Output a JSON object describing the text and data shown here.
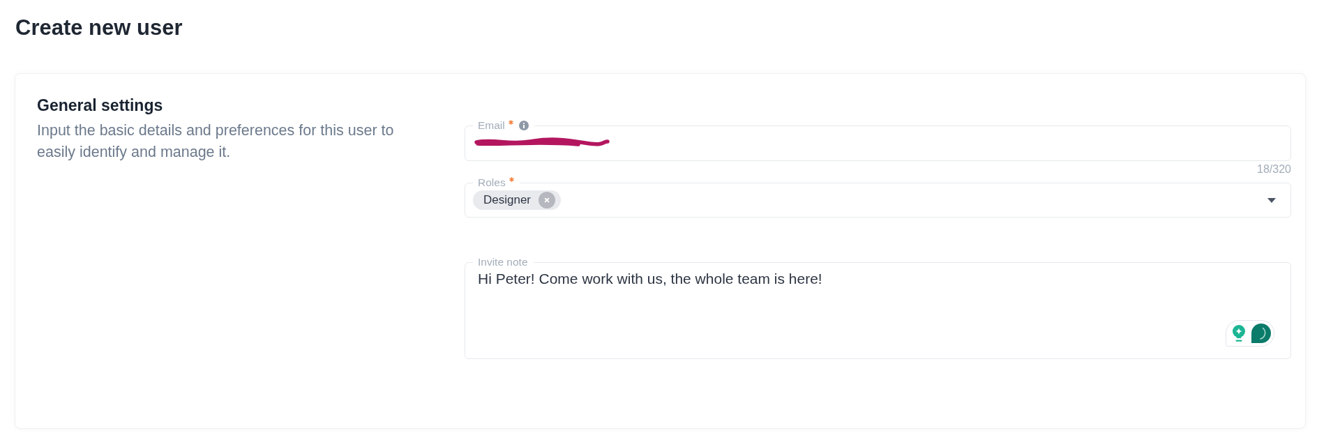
{
  "page": {
    "title": "Create new user"
  },
  "section": {
    "title": "General settings",
    "description": "Input the basic details and preferences for this user to easily identify and manage it."
  },
  "fields": [
    {
      "kind": "text",
      "label": "Email",
      "required": true,
      "info": true,
      "redacted": true,
      "counter": "18/320"
    },
    {
      "kind": "select",
      "label": "Roles",
      "required": true,
      "info": false,
      "chips": [
        {
          "label": "Designer"
        }
      ]
    },
    {
      "kind": "textarea",
      "label": "Invite note",
      "required": false,
      "info": false,
      "value": "Hi Peter! Come work with us, the whole team is here!"
    }
  ]
}
